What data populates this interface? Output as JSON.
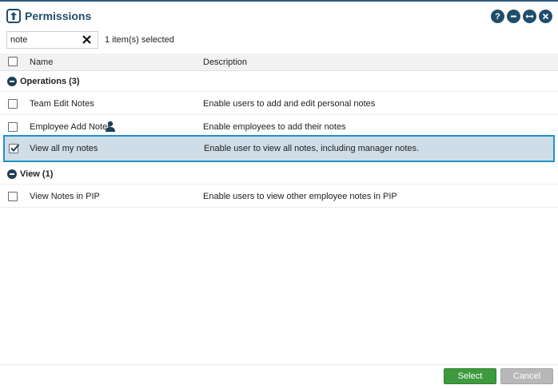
{
  "window": {
    "title": "Permissions",
    "buttons": {
      "help": "?",
      "minimize_icon": "minus-icon",
      "resize_icon": "resize-icon",
      "close_icon": "close-icon"
    }
  },
  "search": {
    "value": "note",
    "clear_icon": "close-icon"
  },
  "selection_status": "1 item(s) selected",
  "table": {
    "columns": {
      "name": "Name",
      "description": "Description"
    }
  },
  "groups": [
    {
      "label": "Operations (3)",
      "rows": [
        {
          "name": "Team Edit Notes",
          "description": "Enable users to add and edit personal notes",
          "checked": false
        },
        {
          "name": "Employee Add Notes",
          "description": "Enable employees to add their notes",
          "checked": false,
          "icon": "person-icon"
        },
        {
          "name": "View all my notes",
          "description": "Enable user to view all notes, including manager notes.",
          "checked": true
        }
      ]
    },
    {
      "label": "View (1)",
      "rows": [
        {
          "name": "View Notes in PIP",
          "description": "Enable users to view other employee notes in PIP",
          "checked": false
        }
      ]
    }
  ],
  "footer": {
    "select_label": "Select",
    "cancel_label": "Cancel"
  },
  "colors": {
    "brand": "#1f4e6b",
    "selected_row_bg": "#cfdde8",
    "selected_row_border": "#1f93c9",
    "select_button": "#3e9a3e",
    "cancel_button": "#b7b7b7"
  }
}
